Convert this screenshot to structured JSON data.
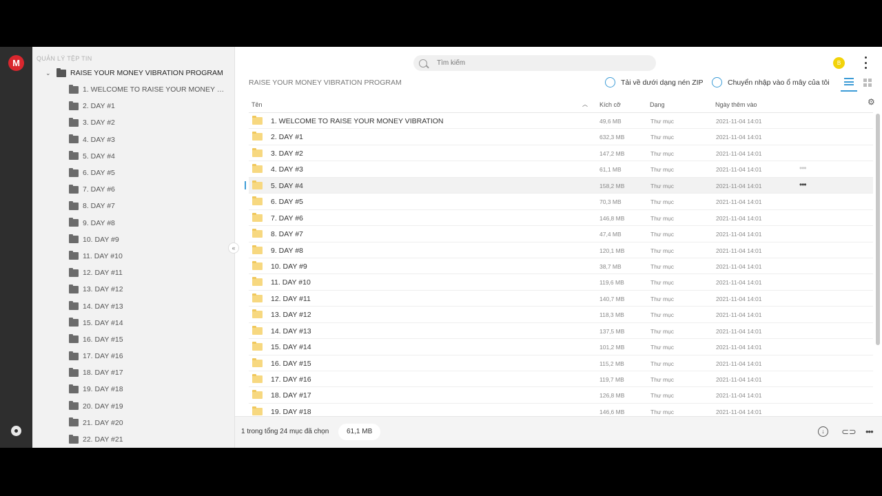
{
  "sidebar": {
    "header": "QUẢN LÝ TỆP TIN",
    "root": "RAISE YOUR MONEY VIBRATION PROGRAM",
    "items": [
      "1. WELCOME TO RAISE YOUR MONEY VIB...",
      "2. DAY #1",
      "3. DAY #2",
      "4. DAY #3",
      "5. DAY #4",
      "6. DAY #5",
      "7. DAY #6",
      "8. DAY #7",
      "9. DAY #8",
      "10. DAY #9",
      "11. DAY #10",
      "12. DAY #11",
      "13. DAY #12",
      "14. DAY #13",
      "15. DAY #14",
      "16. DAY #15",
      "17. DAY #16",
      "18. DAY #17",
      "19. DAY #18",
      "20. DAY #19",
      "21. DAY #20",
      "22. DAY #21"
    ],
    "collapse_glyph": "«"
  },
  "brand": {
    "logo_letter": "M",
    "color": "#d9272e"
  },
  "topbar": {
    "search_placeholder": "Tìm kiếm",
    "avatar_letter": "B"
  },
  "breadcrumb": "RAISE YOUR MONEY VIBRATION PROGRAM",
  "actions": {
    "download_zip": "Tải về dưới dạng nén ZIP",
    "import_cloud": "Chuyển nhập vào ổ mây của tôi"
  },
  "table": {
    "columns": {
      "name": "Tên",
      "size": "Kích cỡ",
      "type": "Dạng",
      "date": "Ngày thêm vào"
    },
    "rows": [
      {
        "name": "1. WELCOME TO RAISE YOUR MONEY VIBRATION",
        "size": "49,6 MB",
        "type": "Thư mục",
        "date": "2021-11-04 14:01"
      },
      {
        "name": "2. DAY #1",
        "size": "632,3 MB",
        "type": "Thư mục",
        "date": "2021-11-04 14:01"
      },
      {
        "name": "3. DAY #2",
        "size": "147,2 MB",
        "type": "Thư mục",
        "date": "2021-11-04 14:01"
      },
      {
        "name": "4. DAY #3",
        "size": "61,1 MB",
        "type": "Thư mục",
        "date": "2021-11-04 14:01"
      },
      {
        "name": "5. DAY #4",
        "size": "158,2 MB",
        "type": "Thư mục",
        "date": "2021-11-04 14:01"
      },
      {
        "name": "6. DAY #5",
        "size": "70,3 MB",
        "type": "Thư mục",
        "date": "2021-11-04 14:01"
      },
      {
        "name": "7. DAY #6",
        "size": "146,8 MB",
        "type": "Thư mục",
        "date": "2021-11-04 14:01"
      },
      {
        "name": "8. DAY #7",
        "size": "47,4 MB",
        "type": "Thư mục",
        "date": "2021-11-04 14:01"
      },
      {
        "name": "9. DAY #8",
        "size": "120,1 MB",
        "type": "Thư mục",
        "date": "2021-11-04 14:01"
      },
      {
        "name": "10. DAY #9",
        "size": "38,7 MB",
        "type": "Thư mục",
        "date": "2021-11-04 14:01"
      },
      {
        "name": "11. DAY #10",
        "size": "119,6 MB",
        "type": "Thư mục",
        "date": "2021-11-04 14:01"
      },
      {
        "name": "12. DAY #11",
        "size": "140,7 MB",
        "type": "Thư mục",
        "date": "2021-11-04 14:01"
      },
      {
        "name": "13. DAY #12",
        "size": "118,3 MB",
        "type": "Thư mục",
        "date": "2021-11-04 14:01"
      },
      {
        "name": "14. DAY #13",
        "size": "137,5 MB",
        "type": "Thư mục",
        "date": "2021-11-04 14:01"
      },
      {
        "name": "15. DAY #14",
        "size": "101,2 MB",
        "type": "Thư mục",
        "date": "2021-11-04 14:01"
      },
      {
        "name": "16. DAY #15",
        "size": "115,2 MB",
        "type": "Thư mục",
        "date": "2021-11-04 14:01"
      },
      {
        "name": "17. DAY #16",
        "size": "119,7 MB",
        "type": "Thư mục",
        "date": "2021-11-04 14:01"
      },
      {
        "name": "18. DAY #17",
        "size": "126,8 MB",
        "type": "Thư mục",
        "date": "2021-11-04 14:01"
      },
      {
        "name": "19. DAY #18",
        "size": "146,6 MB",
        "type": "Thư mục",
        "date": "2021-11-04 14:01"
      }
    ],
    "selected_row": "5. DAY #4",
    "row_more_glyph": "•••"
  },
  "footer": {
    "selection_text": "1 trong tổng 24 mục đã chọn",
    "selection_size": "61,1 MB"
  },
  "colors": {
    "accent": "#3b9bd6",
    "folder": "#f7d880",
    "avatar": "#f2d30a"
  }
}
